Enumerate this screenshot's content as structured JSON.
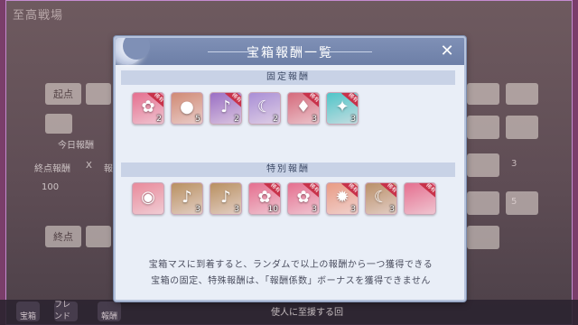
{
  "background": {
    "title": "至高戦場",
    "labels": [
      "起点",
      "今日報酬",
      "終点"
    ],
    "reward_row": {
      "label": "終点報酬",
      "x": "X",
      "extra": "報",
      "points": "100"
    },
    "bottom_buttons": [
      "宝箱",
      "フレンド",
      "報酬"
    ],
    "bottom_text": "使人に至援する回",
    "chips": [
      "3",
      "5"
    ]
  },
  "dialog": {
    "title": "宝箱報酬一覧",
    "close_label": "✕",
    "fixed_section": {
      "label": "固定報酬",
      "items": [
        {
          "name": "pink-fan",
          "glyph": "✿",
          "count": "2",
          "rare": true,
          "color": "#e56f8f"
        },
        {
          "name": "coin",
          "glyph": "●",
          "count": "5",
          "rare": false,
          "color": "#d08a74"
        },
        {
          "name": "bell",
          "glyph": "♪",
          "count": "2",
          "rare": true,
          "color": "#9a6fc4"
        },
        {
          "name": "moon",
          "glyph": "☾",
          "count": "2",
          "rare": false,
          "color": "#a98fd6"
        },
        {
          "name": "pouch",
          "glyph": "♦",
          "count": "3",
          "rare": true,
          "color": "#d56a7b"
        },
        {
          "name": "crystal",
          "glyph": "✦",
          "count": "3",
          "rare": true,
          "color": "#4fc5c8"
        }
      ],
      "rare_label": "稀有"
    },
    "special_section": {
      "label": "特別報酬",
      "items": [
        {
          "name": "orb-stand",
          "glyph": "◉",
          "count": "",
          "rare": false,
          "color": "#e98a9b"
        },
        {
          "name": "bell-green",
          "glyph": "♪",
          "count": "3",
          "rare": false,
          "color": "#b89061"
        },
        {
          "name": "bell-gold",
          "glyph": "♪",
          "count": "3",
          "rare": false,
          "color": "#b89061"
        },
        {
          "name": "pink-fan",
          "glyph": "✿",
          "count": "10",
          "rare": true,
          "color": "#e56f8f"
        },
        {
          "name": "pink-fan-2",
          "glyph": "✿",
          "count": "3",
          "rare": true,
          "color": "#e56f8f"
        },
        {
          "name": "sun-badge",
          "glyph": "✹",
          "count": "3",
          "rare": true,
          "color": "#e99b84"
        },
        {
          "name": "moon-badge",
          "glyph": "☾",
          "count": "3",
          "rare": true,
          "color": "#b98f68"
        },
        {
          "name": "partial",
          "glyph": "",
          "count": "",
          "rare": true,
          "color": "#e56f8f"
        }
      ],
      "rare_label": "稀有"
    },
    "description": {
      "line1": "宝箱マスに到着すると、ランダムで以上の報酬から一つ獲得できる",
      "line2": "宝箱の固定、特殊報酬は、「報酬係数」ボーナスを獲得できません"
    }
  }
}
